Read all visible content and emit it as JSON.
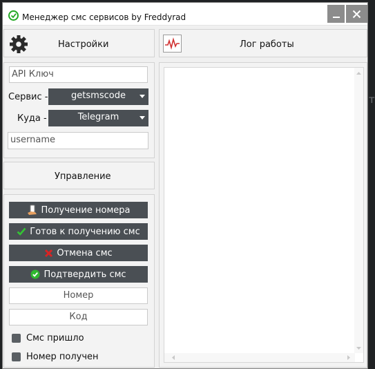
{
  "window": {
    "title": "Менеджер смс сервисов by Freddyrad"
  },
  "settings": {
    "title": "Настройки"
  },
  "log": {
    "title": "Лог работы",
    "content": ""
  },
  "fields": {
    "api_key_placeholder": "API Ключ",
    "service_label": "Сервис -",
    "service_value": "getsmscode",
    "target_label": "Куда -",
    "target_value": "Telegram",
    "username_placeholder": "username"
  },
  "control": {
    "title": "Управление",
    "buttons": [
      {
        "label": "Получение номера",
        "icon": "phone-hand-icon"
      },
      {
        "label": "Готов к получению смс",
        "icon": "checkmark-icon"
      },
      {
        "label": "Отмена смс",
        "icon": "red-x-icon"
      },
      {
        "label": "Подтвердить смс",
        "icon": "green-check-circle-icon"
      }
    ],
    "number_placeholder": "Номер",
    "code_placeholder": "Код",
    "checkboxes": [
      {
        "label": "Смс пришло",
        "checked": false
      },
      {
        "label": "Номер получен",
        "checked": false
      }
    ]
  },
  "colors": {
    "button_bg": "#4a4f54",
    "window_bg": "#f0f0f0",
    "titlebar_btn": "#8c8c8c"
  }
}
